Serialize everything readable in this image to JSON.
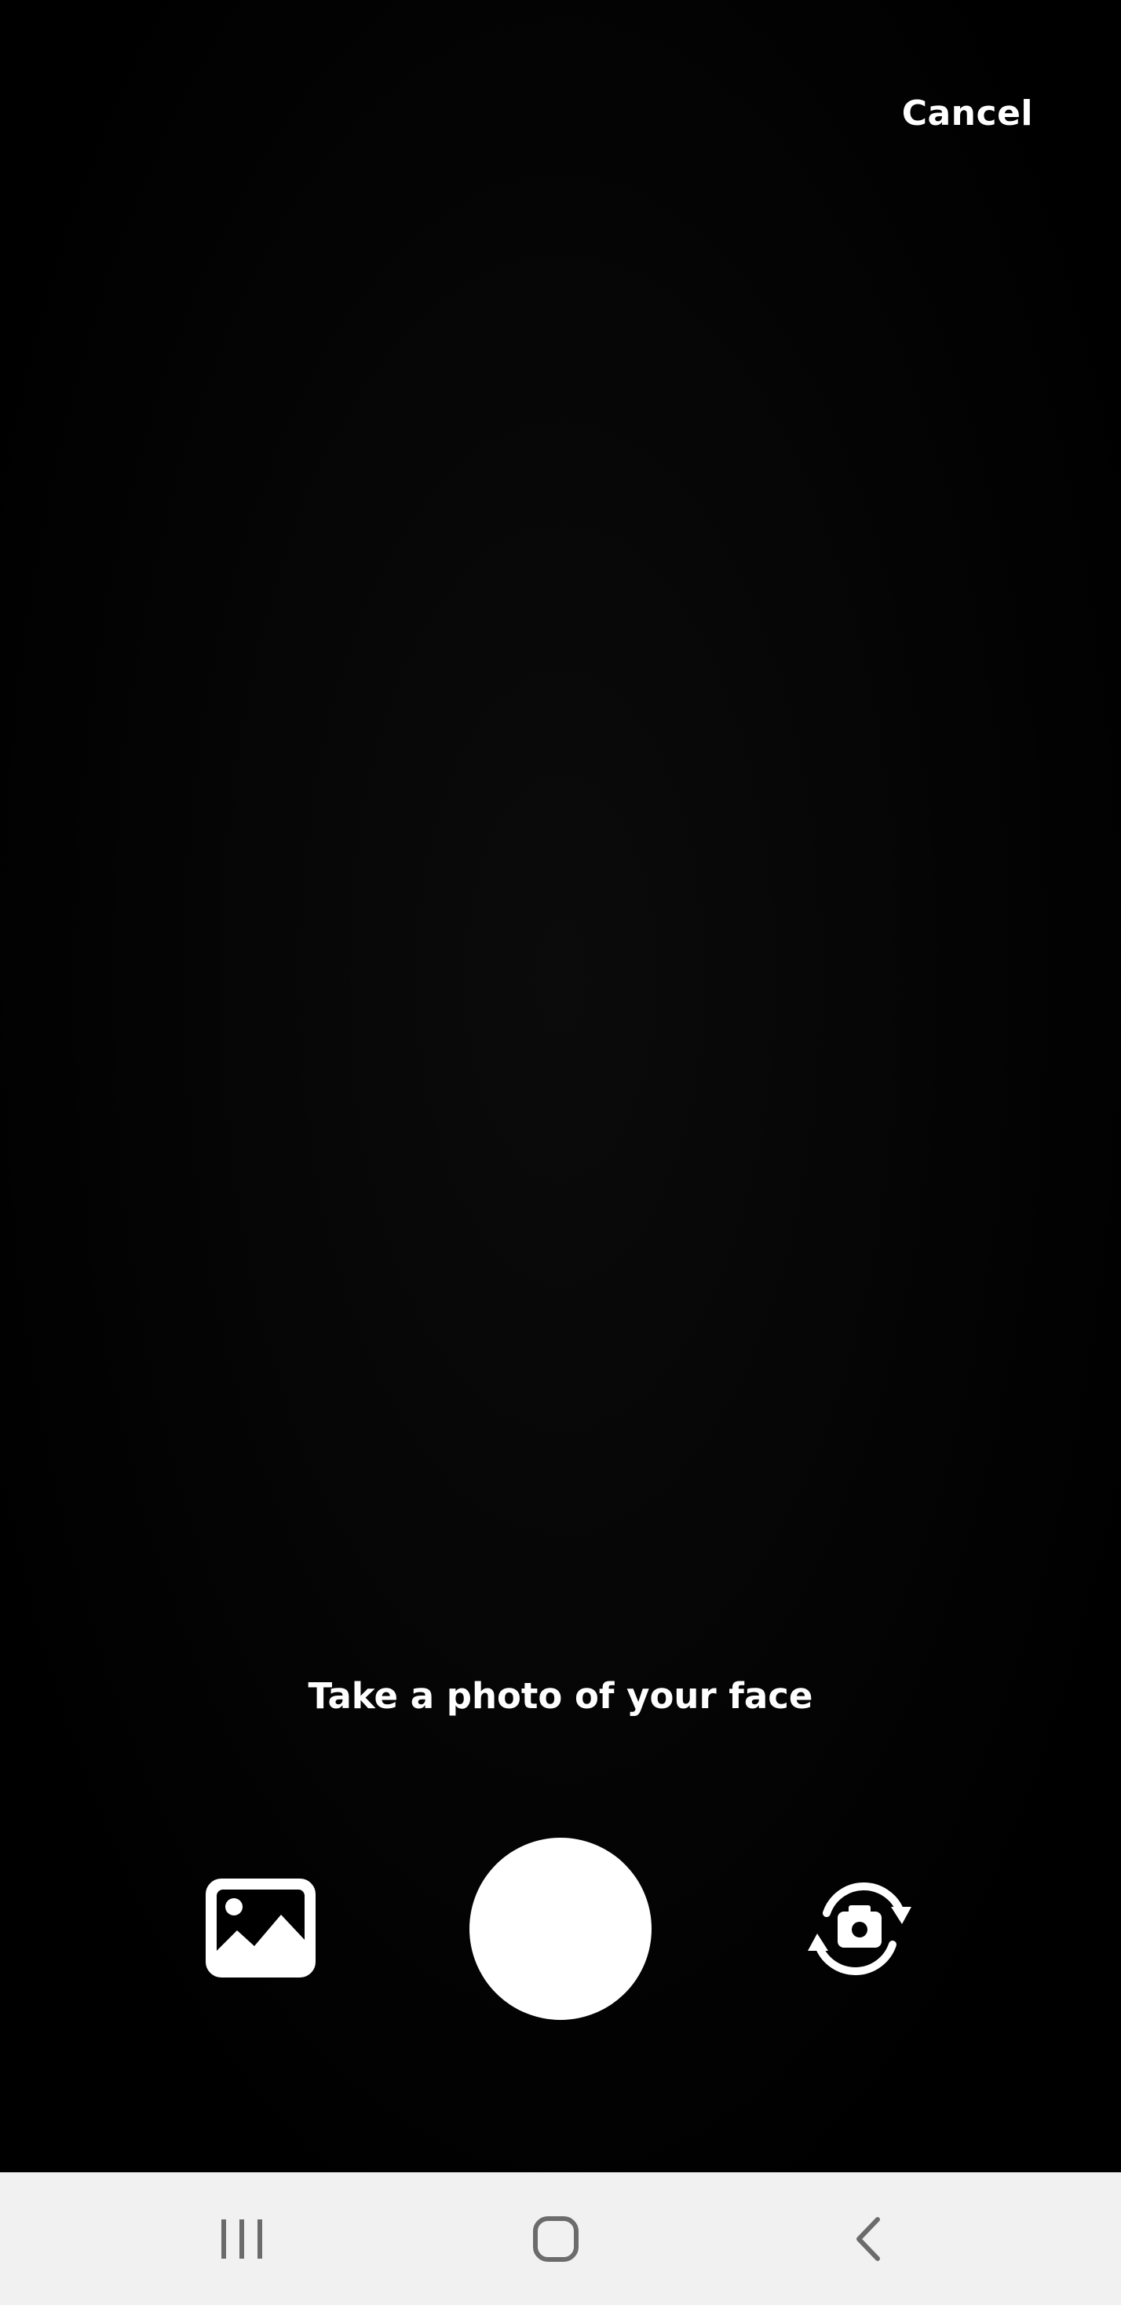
{
  "camera": {
    "cancel_label": "Cancel",
    "prompt": "Take a photo of your face"
  },
  "controls": {
    "gallery_icon": "gallery-icon",
    "shutter_icon": "shutter-button",
    "flip_icon": "flip-camera-icon"
  },
  "navbar": {
    "recents_icon": "recents-icon",
    "home_icon": "home-icon",
    "back_icon": "back-icon"
  },
  "colors": {
    "background": "#000000",
    "foreground": "#ffffff",
    "navbar_bg": "#f1f1f1",
    "navbar_icon": "#6b6b6b"
  }
}
